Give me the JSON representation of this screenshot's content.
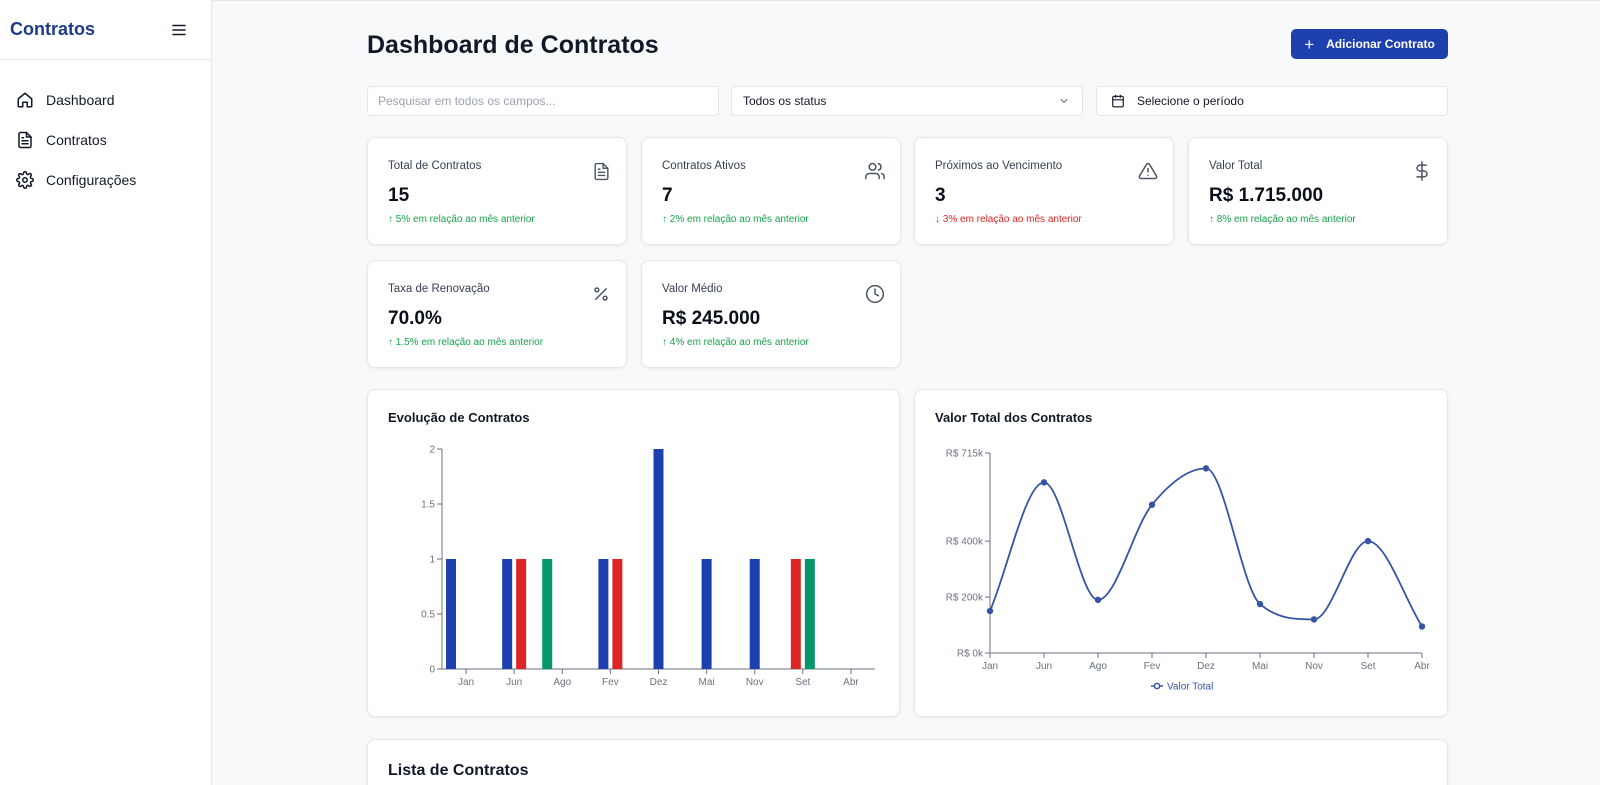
{
  "sidebar": {
    "brand": "Contratos",
    "items": [
      {
        "label": "Dashboard",
        "icon": "home-icon"
      },
      {
        "label": "Contratos",
        "icon": "file-text-icon"
      },
      {
        "label": "Configurações",
        "icon": "gear-icon"
      }
    ]
  },
  "header": {
    "title": "Dashboard de Contratos",
    "add_button": "Adicionar Contrato"
  },
  "filters": {
    "search_placeholder": "Pesquisar em todos os campos...",
    "status_value": "Todos os status",
    "period_placeholder": "Selecione o período"
  },
  "cards": [
    {
      "label": "Total de Contratos",
      "value": "15",
      "delta": "↑ 5% em relação ao mês anterior",
      "trend": "up",
      "icon": "file-text-icon"
    },
    {
      "label": "Contratos Ativos",
      "value": "7",
      "delta": "↑ 2% em relação ao mês anterior",
      "trend": "up",
      "icon": "users-icon"
    },
    {
      "label": "Próximos ao Vencimento",
      "value": "3",
      "delta": "↓ 3% em relação ao mês anterior",
      "trend": "down",
      "icon": "alert-triangle-icon"
    },
    {
      "label": "Valor Total",
      "value": "R$ 1.715.000",
      "delta": "↑ 8% em relação ao mês anterior",
      "trend": "up",
      "icon": "dollar-sign-icon"
    },
    {
      "label": "Taxa de Renovação",
      "value": "70.0%",
      "delta": "↑ 1.5% em relação ao mês anterior",
      "trend": "up",
      "icon": "percent-icon"
    },
    {
      "label": "Valor Médio",
      "value": "R$ 245.000",
      "delta": "↑ 4% em relação ao mês anterior",
      "trend": "up",
      "icon": "clock-icon"
    }
  ],
  "colors": {
    "primary": "#1e40af",
    "blue": "#1e40af",
    "red": "#dc2626",
    "green": "#059669",
    "line": "#3554a5",
    "up": "#16a34a",
    "down": "#dc2626"
  },
  "chart_data": [
    {
      "type": "bar",
      "title": "Evolução de Contratos",
      "ylim": [
        0,
        2
      ],
      "yticks": [
        "0",
        "0.5",
        "1",
        "1.5",
        "2"
      ],
      "categories": [
        "Jan",
        "Jun",
        "Ago",
        "Fev",
        "Dez",
        "Mai",
        "Nov",
        "Set",
        "Abr"
      ],
      "groups": [
        [
          {
            "value": 1,
            "color": "blue"
          }
        ],
        [
          {
            "value": 1,
            "color": "blue"
          },
          {
            "value": 1,
            "color": "red"
          }
        ],
        [
          {
            "value": 1,
            "color": "green"
          }
        ],
        [
          {
            "value": 1,
            "color": "blue"
          },
          {
            "value": 1,
            "color": "red"
          }
        ],
        [
          {
            "value": 2,
            "color": "blue"
          }
        ],
        [
          {
            "value": 1,
            "color": "blue"
          }
        ],
        [
          {
            "value": 1,
            "color": "blue"
          }
        ],
        [
          {
            "value": 1,
            "color": "red"
          },
          {
            "value": 1,
            "color": "green"
          }
        ],
        []
      ],
      "grid": false
    },
    {
      "type": "line",
      "title": "Valor Total dos Contratos",
      "categories": [
        "Jan",
        "Jun",
        "Ago",
        "Fev",
        "Dez",
        "Mai",
        "Nov",
        "Set",
        "Abr"
      ],
      "series": [
        {
          "name": "Valor Total",
          "values": [
            150000,
            610000,
            190000,
            530000,
            660000,
            175000,
            120000,
            400000,
            95000
          ]
        }
      ],
      "ylim": [
        0,
        715000
      ],
      "yticks": [
        {
          "value": 0,
          "label": "R$ 0k"
        },
        {
          "value": 200000,
          "label": "R$ 200k"
        },
        {
          "value": 400000,
          "label": "R$ 400k"
        },
        {
          "value": 715000,
          "label": "R$ 715k"
        }
      ],
      "legend": "bottom",
      "grid": false
    }
  ],
  "list": {
    "title": "Lista de Contratos"
  }
}
